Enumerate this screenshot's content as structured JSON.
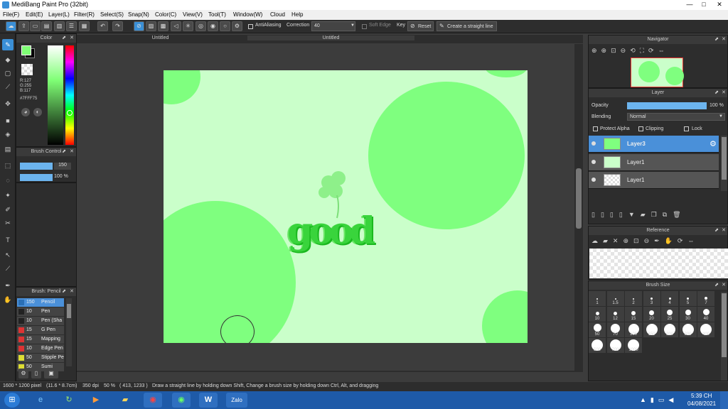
{
  "window": {
    "title": "MediBang Paint Pro (32bit)",
    "min": "—",
    "max": "□",
    "close": "✕"
  },
  "menu": [
    "File(F)",
    "Edit(E)",
    "Layer(L)",
    "Filter(R)",
    "Select(S)",
    "Snap(N)",
    "Color(C)",
    "View(V)",
    "Tool(T)",
    "Window(W)",
    "Cloud",
    "Help"
  ],
  "toolbar": {
    "antialiasing": "AntiAliasing",
    "correction_label": "Correction",
    "correction_value": "40",
    "soft_edge": "Soft Edge",
    "key": "Key",
    "reset": "Reset",
    "straight_line": "Create a straight line"
  },
  "tabs": [
    "Untitled",
    "Untitled"
  ],
  "color_panel": {
    "title": "Color",
    "rgb": "R:127\nG:255\nB:117",
    "hex": "#7FFF75",
    "primary": "#7fff75",
    "secondary": "#000000"
  },
  "brush_control": {
    "title": "Brush Control",
    "size": "150",
    "opacity": "100 %"
  },
  "brush_panel": {
    "title": "Brush: Pencil",
    "items": [
      {
        "size": "150",
        "name": "Pencil",
        "color": "#2a6fb5"
      },
      {
        "size": "10",
        "name": "Pen",
        "color": "#222"
      },
      {
        "size": "10",
        "name": "Pen (Sha",
        "color": "#222"
      },
      {
        "size": "15",
        "name": "G Pen",
        "color": "#d33"
      },
      {
        "size": "15",
        "name": "Mapping",
        "color": "#d33"
      },
      {
        "size": "10",
        "name": "Edge Pen",
        "color": "#d33"
      },
      {
        "size": "50",
        "name": "Stipple Pe",
        "color": "#dd3"
      },
      {
        "size": "50",
        "name": "Sumi",
        "color": "#dd3"
      }
    ]
  },
  "navigator": {
    "title": "Navigator"
  },
  "layer_panel": {
    "title": "Layer",
    "opacity_label": "Opacity",
    "opacity_value": "100 %",
    "blending_label": "Blending",
    "blending_value": "Normal",
    "protect_alpha": "Protect Alpha",
    "clipping": "Clipping",
    "lock": "Lock",
    "layers": [
      {
        "name": "Layer3"
      },
      {
        "name": "Layer1"
      },
      {
        "name": "Layer1"
      }
    ]
  },
  "reference": {
    "title": "Reference"
  },
  "brush_size": {
    "title": "Brush Size",
    "sizes": [
      "1",
      "1.5",
      "2",
      "3",
      "4",
      "5",
      "7",
      "10",
      "12",
      "15",
      "20",
      "25",
      "30",
      "40",
      "50",
      "70",
      "100",
      "150",
      "200",
      "300",
      "400",
      "500",
      "700",
      "1000"
    ]
  },
  "canvas": {
    "text": "good"
  },
  "status": {
    "pixels": "1600 * 1200 pixel",
    "cm": "(11.6 * 8.7cm)",
    "dpi": "350 dpi",
    "zoom": "50 %",
    "coords": "( 413, 1233 )",
    "hint": "Draw a straight line by holding down Shift, Change a brush size by holding down Ctrl, Alt, and dragging"
  },
  "taskbar": {
    "time": "5:39 CH",
    "date": "04/08/2021",
    "zalo": "Zalo"
  }
}
